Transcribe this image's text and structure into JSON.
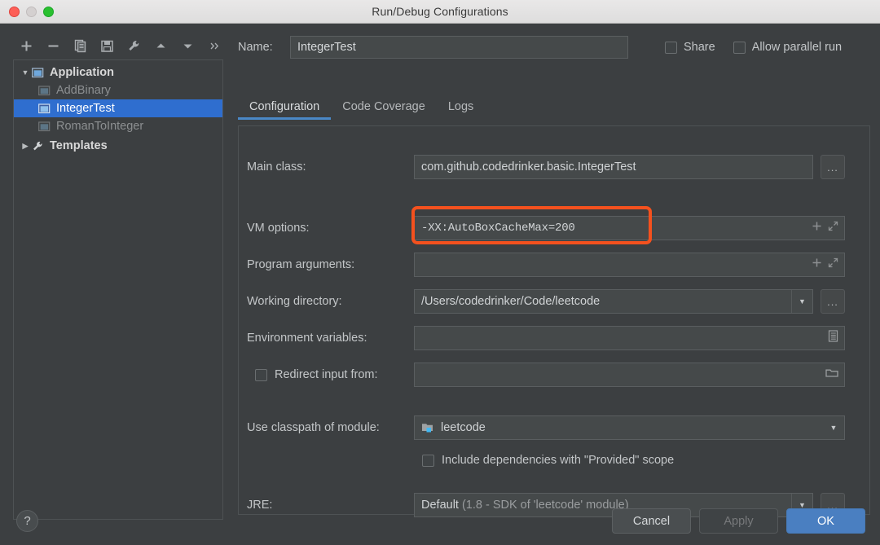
{
  "window": {
    "title": "Run/Debug Configurations",
    "traffic_lights": [
      "close",
      "minimize",
      "zoom"
    ]
  },
  "toolbar": {
    "buttons": [
      {
        "name": "add-icon",
        "label": "+"
      },
      {
        "name": "remove-icon",
        "label": "−"
      },
      {
        "name": "copy-icon",
        "label": "Copy"
      },
      {
        "name": "save-icon",
        "label": "Save"
      },
      {
        "name": "wrench-icon",
        "label": "Edit defaults"
      },
      {
        "name": "move-up-icon",
        "label": "Move Up"
      },
      {
        "name": "move-down-icon",
        "label": "Move Down"
      },
      {
        "name": "more-icon",
        "label": "»"
      }
    ]
  },
  "tree": {
    "items": [
      {
        "label": "Application",
        "level": 0,
        "expanded": true,
        "selected": false,
        "icon": "application-icon"
      },
      {
        "label": "AddBinary",
        "level": 1,
        "expanded": false,
        "selected": false,
        "icon": "run-config-icon"
      },
      {
        "label": "IntegerTest",
        "level": 1,
        "expanded": false,
        "selected": true,
        "icon": "run-config-icon"
      },
      {
        "label": "RomanToInteger",
        "level": 1,
        "expanded": false,
        "selected": false,
        "icon": "run-config-icon"
      },
      {
        "label": "Templates",
        "level": 0,
        "expanded": false,
        "selected": false,
        "icon": "wrench-icon"
      }
    ]
  },
  "name_row": {
    "label": "Name:",
    "value": "IntegerTest",
    "placeholder": "",
    "share": {
      "label": "Share",
      "checked": false
    },
    "allow_parallel": {
      "label": "Allow parallel run",
      "checked": false
    }
  },
  "tabs": [
    {
      "label": "Configuration",
      "active": true
    },
    {
      "label": "Code Coverage",
      "active": false
    },
    {
      "label": "Logs",
      "active": false
    }
  ],
  "form": {
    "main_class": {
      "label": "Main class:",
      "value": "com.github.codedrinker.basic.IntegerTest",
      "browse_label": "..."
    },
    "vm_options": {
      "label": "VM options:",
      "value": "-XX:AutoBoxCacheMax=200",
      "expand_icon": "expand-icon",
      "macro_icon": "plus-icon"
    },
    "program_arguments": {
      "label": "Program arguments:",
      "value": "",
      "expand_icon": "expand-icon",
      "macro_icon": "plus-icon"
    },
    "working_directory": {
      "label": "Working directory:",
      "value": "/Users/codedrinker/Code/leetcode",
      "browse_label": "..."
    },
    "environment_variables": {
      "label": "Environment variables:",
      "value": "",
      "edit_icon": "list-edit-icon"
    },
    "redirect_input": {
      "label": "Redirect input from:",
      "checked": false,
      "value": "",
      "folder_icon": "folder-icon"
    },
    "use_classpath": {
      "label": "Use classpath of module:",
      "value": "leetcode",
      "icon": "module-icon"
    },
    "include_dependencies": {
      "label": "Include dependencies with \"Provided\" scope",
      "checked": false
    },
    "jre": {
      "label": "JRE:",
      "value_primary": "Default",
      "value_secondary": "(1.8 - SDK of 'leetcode' module)",
      "browse_label": "..."
    }
  },
  "annotation": {
    "target": "vm-options-field",
    "color": "#f4511e"
  },
  "footer": {
    "help_label": "?",
    "cancel_label": "Cancel",
    "apply_label": "Apply",
    "ok_label": "OK"
  }
}
